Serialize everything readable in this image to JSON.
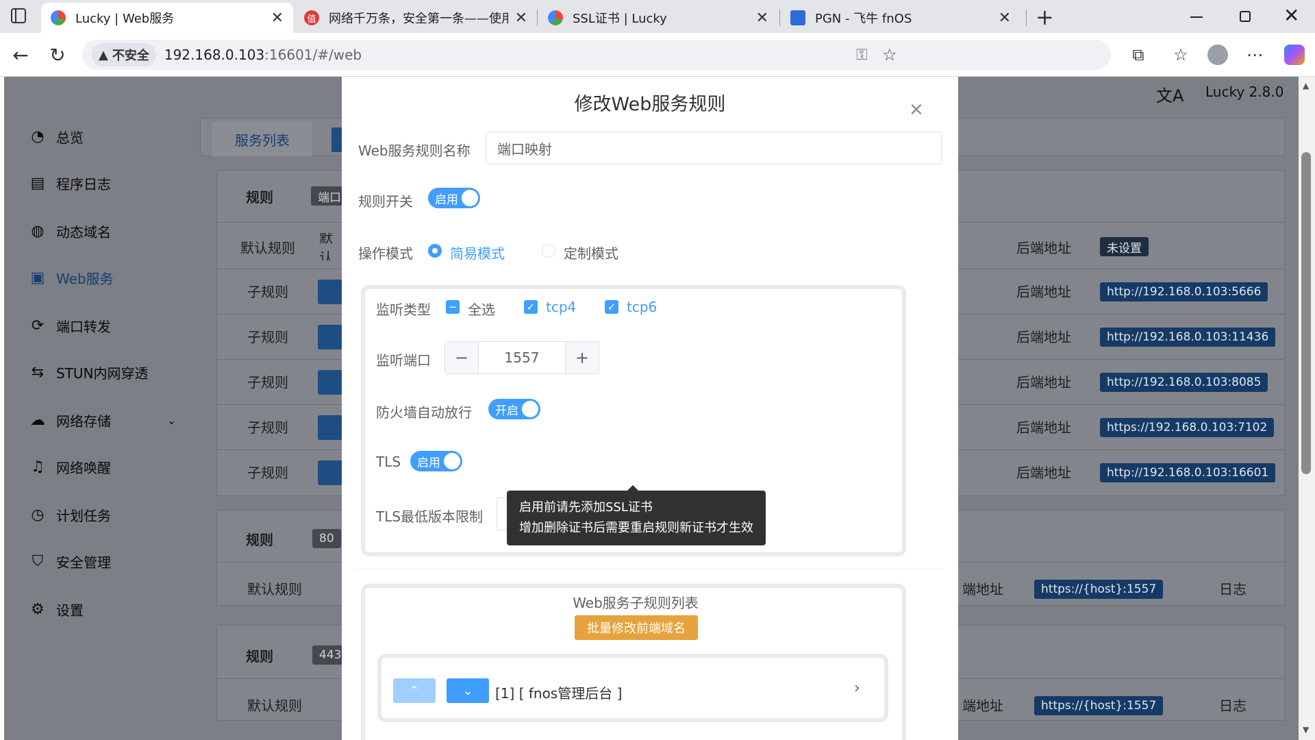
{
  "browser": {
    "tabs": [
      {
        "title": "Lucky | Web服务",
        "active": true
      },
      {
        "title": "网络千万条，安全第一条——使用"
      },
      {
        "title": "SSL证书 | Lucky"
      },
      {
        "title": "PGN - 飞牛 fnOS"
      }
    ],
    "security_label": "不安全",
    "url_host": "192.168.0.103",
    "url_rest": ":16601/#/web"
  },
  "app": {
    "version": "Lucky 2.8.0",
    "sidebar": [
      {
        "label": "总览",
        "icon": "dashboard-icon"
      },
      {
        "label": "程序日志",
        "icon": "log-icon"
      },
      {
        "label": "动态域名",
        "icon": "dns-icon"
      },
      {
        "label": "Web服务",
        "icon": "web-service-icon",
        "active": true
      },
      {
        "label": "端口转发",
        "icon": "port-forward-icon"
      },
      {
        "label": "STUN内网穿透",
        "icon": "stun-icon"
      },
      {
        "label": "网络存储",
        "icon": "cloud-storage-icon"
      },
      {
        "label": "网络唤醒",
        "icon": "bell-icon"
      },
      {
        "label": "计划任务",
        "icon": "clock-icon"
      },
      {
        "label": "安全管理",
        "icon": "shield-icon"
      },
      {
        "label": "设置",
        "icon": "gear-icon"
      }
    ],
    "tab_label": "服务列表",
    "table": {
      "rule_label": "规则",
      "default_rule": "默认规则",
      "sub_rule": "子规则",
      "backend_label": "后端地址",
      "backend_label_cut": "端地址",
      "not_set": "未设置",
      "log_label": "日志",
      "chip1_cut": "端口",
      "chip2_cut": "80",
      "chip3_cut": "443",
      "default_cut": "默认",
      "backends": [
        "http://192.168.0.103:5666",
        "http://192.168.0.103:11436",
        "http://192.168.0.103:8085",
        "https://192.168.0.103:7102",
        "http://192.168.0.103:16601"
      ],
      "host_backend": "https://{host}:1557"
    }
  },
  "dialog": {
    "title": "修改Web服务规则",
    "name_label": "Web服务规则名称",
    "name_value": "端口映射",
    "switch_label": "规则开关",
    "switch_on": "启用",
    "mode_label": "操作模式",
    "mode_simple": "简易模式",
    "mode_custom": "定制模式",
    "listen_type_label": "监听类型",
    "select_all": "全选",
    "tcp4": "tcp4",
    "tcp6": "tcp6",
    "listen_port_label": "监听端口",
    "listen_port_value": "1557",
    "firewall_label": "防火墙自动放行",
    "firewall_on": "开启",
    "tls_label": "TLS",
    "tls_on": "启用",
    "tls_min_label": "TLS最低版本限制",
    "tooltip_line1": "启用前请先添加SSL证书",
    "tooltip_line2": "增加删除证书后需要重启规则新证书才生效",
    "sub_list_title": "Web服务子规则列表",
    "batch_button": "批量修改前端域名",
    "sub_item": "[1] [ fnos管理后台 ]"
  }
}
